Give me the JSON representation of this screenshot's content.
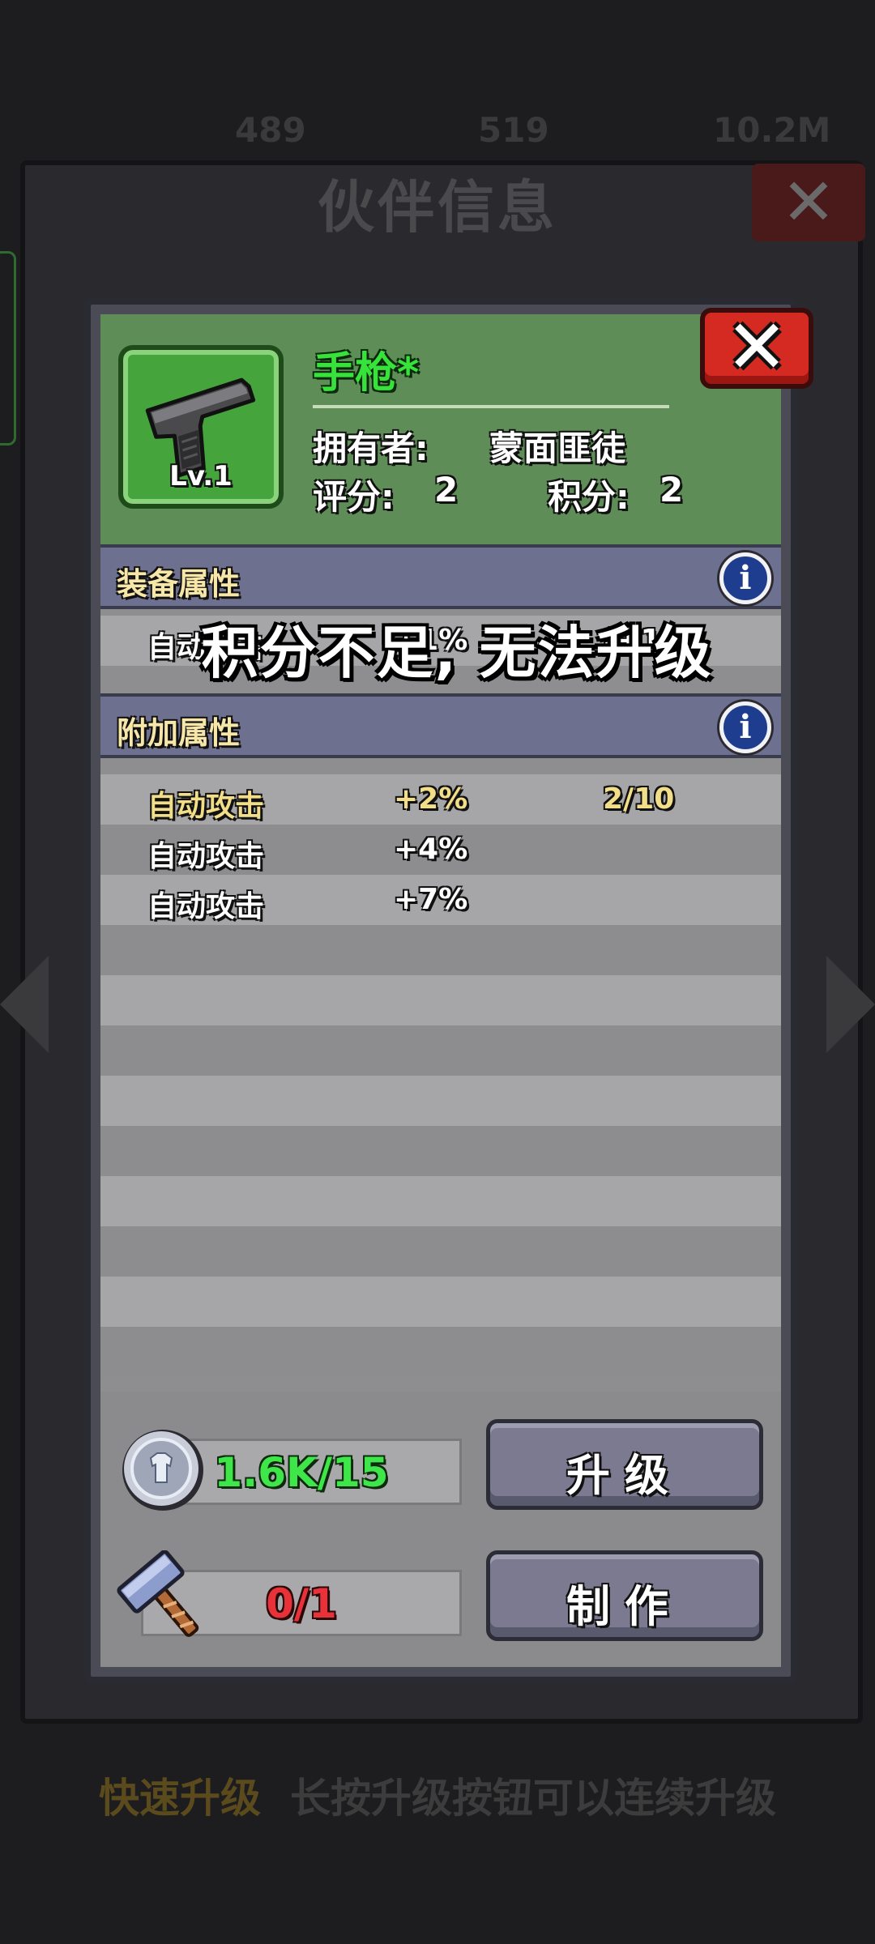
{
  "background": {
    "top_values": [
      "489",
      "519",
      "10.2M"
    ],
    "title": "伙伴信息",
    "hint_key": "快速升级",
    "hint_desc": "长按升级按钮可以连续升级"
  },
  "item": {
    "name": "手枪*",
    "level": "Lv.1",
    "owner_label": "拥有者:",
    "owner_value": "蒙面匪徒",
    "rating_label": "评分:",
    "rating_value": "2",
    "points_label": "积分:",
    "points_value": "2"
  },
  "equip_section": {
    "title": "装备属性",
    "row": {
      "name": "自动攻击",
      "value": "+1%",
      "extra": "(+1%)"
    }
  },
  "extra_section": {
    "title": "附加属性",
    "rows": [
      {
        "name": "自动攻击",
        "value": "+2%",
        "progress": "2/10",
        "active": true
      },
      {
        "name": "自动攻击",
        "value": "+4%",
        "progress": "",
        "active": false
      },
      {
        "name": "自动攻击",
        "value": "+7%",
        "progress": "",
        "active": false
      }
    ]
  },
  "toast": "积分不足, 无法升级",
  "footer": {
    "upgrade_cost": "1.6K/15",
    "upgrade_label": "升级",
    "craft_cost": "0/1",
    "craft_label": "制作"
  },
  "colors": {
    "header_green": "#5f8d58",
    "name_green": "#37e33b",
    "close_red": "#d42a22",
    "section_bar": "#6e7090",
    "cost_red": "#e8323a"
  }
}
